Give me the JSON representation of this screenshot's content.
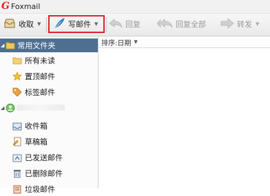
{
  "window": {
    "title": "Foxmail",
    "logo_text": "G"
  },
  "toolbar": {
    "receive_label": "收取",
    "compose_label": "写邮件",
    "reply_label": "回复",
    "reply_all_label": "回复全部",
    "forward_label": "转发"
  },
  "sidebar": {
    "section_label": "常用文件夹",
    "common_items": [
      {
        "label": "所有未读",
        "icon": "folder-icon"
      },
      {
        "label": "置顶邮件",
        "icon": "star-icon"
      },
      {
        "label": "标签邮件",
        "icon": "tag-icon"
      }
    ],
    "account_items": [
      {
        "label": "收件箱",
        "icon": "inbox-icon"
      },
      {
        "label": "草稿箱",
        "icon": "draft-icon"
      },
      {
        "label": "已发送邮件",
        "icon": "sent-icon"
      },
      {
        "label": "已删除邮件",
        "icon": "trash-icon"
      },
      {
        "label": "垃圾邮件",
        "icon": "spam-icon"
      }
    ]
  },
  "mail_list": {
    "sort_label": "排序:日期"
  },
  "colors": {
    "accent": "#e0202a",
    "sidebar_header": "#4f6f92"
  }
}
